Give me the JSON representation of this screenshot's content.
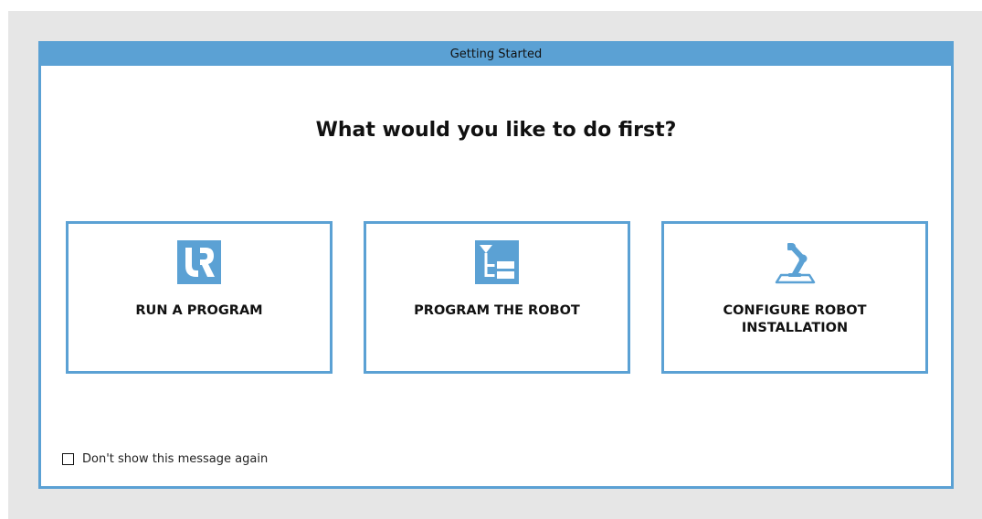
{
  "dialog": {
    "title": "Getting Started",
    "heading": "What would you like to do first?"
  },
  "options": [
    {
      "label": "RUN A PROGRAM",
      "icon": "ur-logo-icon"
    },
    {
      "label": "PROGRAM THE ROBOT",
      "icon": "program-tree-icon"
    },
    {
      "label": "CONFIGURE ROBOT\nINSTALLATION",
      "icon": "robot-arm-icon"
    }
  ],
  "dont_show": {
    "label": "Don't show this message again",
    "checked": false
  },
  "colors": {
    "accent": "#5ba1d4",
    "backdrop": "#e6e6e6"
  }
}
